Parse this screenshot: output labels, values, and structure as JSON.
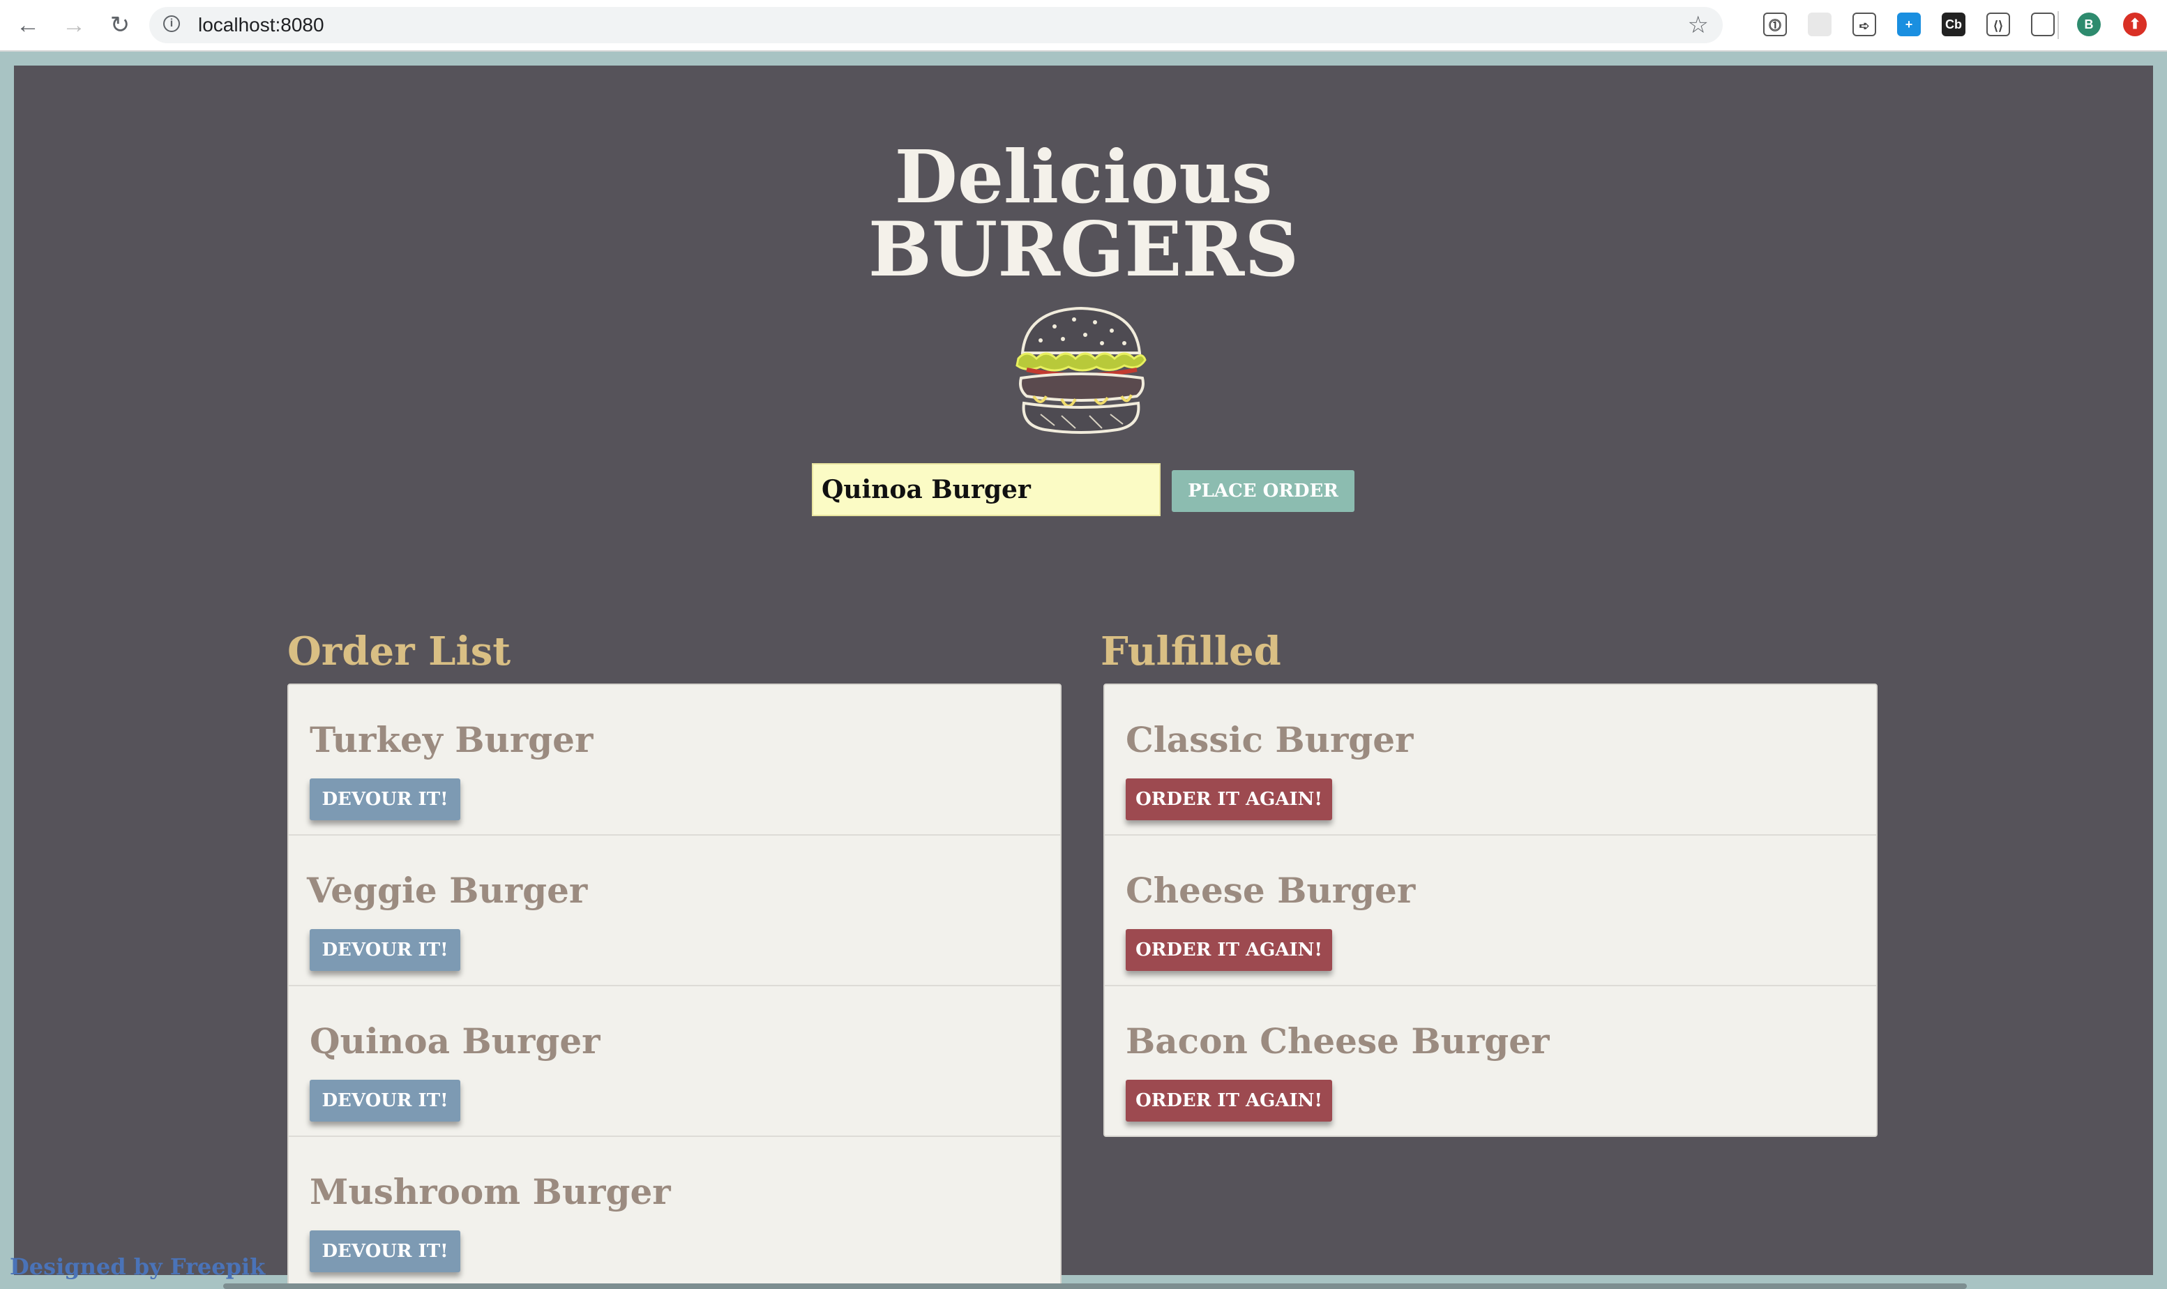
{
  "browser": {
    "url": "localhost:8080",
    "back_icon": "←",
    "forward_icon": "→",
    "reload_icon": "↻",
    "star_icon": "☆",
    "profile_initial": "B",
    "extensions": [
      {
        "name": "password-manager-icon",
        "glyph": "⓵",
        "color": "#ffffff"
      },
      {
        "name": "extension-grid-icon",
        "glyph": "",
        "color": "#e8e8e8"
      },
      {
        "name": "extension-red-arrow-icon",
        "glyph": "➪",
        "color": "#ffffff"
      },
      {
        "name": "extension-blue-plus-icon",
        "glyph": "+",
        "color": "#1a8fe0"
      },
      {
        "name": "extension-cb-icon",
        "glyph": "Cb",
        "color": "#222222"
      },
      {
        "name": "extension-code-icon",
        "glyph": "⟨⟩",
        "color": "#ffffff"
      },
      {
        "name": "extension-chart-icon",
        "glyph": "",
        "color": "#ffffff"
      }
    ]
  },
  "header": {
    "title_line1": "Delicious",
    "title_line2": "BURGERS",
    "logo_icon": "burger-icon"
  },
  "order_form": {
    "input_value": "Quinoa Burger",
    "place_order_label": "PLACE ORDER"
  },
  "order_list": {
    "heading": "Order List",
    "items": [
      {
        "name": "Turkey Burger",
        "button": "DEVOUR IT!"
      },
      {
        "name": "Veggie Burger",
        "button": "DEVOUR IT!"
      },
      {
        "name": "Quinoa Burger",
        "button": "DEVOUR IT!"
      },
      {
        "name": "Mushroom Burger",
        "button": "DEVOUR IT!"
      }
    ]
  },
  "fulfilled": {
    "heading": "Fulfilled",
    "items": [
      {
        "name": "Classic Burger",
        "button": "ORDER IT AGAIN!"
      },
      {
        "name": "Cheese Burger",
        "button": "ORDER IT AGAIN!"
      },
      {
        "name": "Bacon Cheese Burger",
        "button": "ORDER IT AGAIN!"
      }
    ]
  },
  "footer": {
    "credit": "Designed by Freepik"
  },
  "colors": {
    "page_bg": "#56535a",
    "outer_bg": "#a8c3c3",
    "heading_gold": "#d9bf84",
    "devour_btn": "#7d9ab3",
    "again_btn": "#9d4a50",
    "place_btn": "#8cbcb0",
    "input_bg": "#fbfbc5"
  }
}
